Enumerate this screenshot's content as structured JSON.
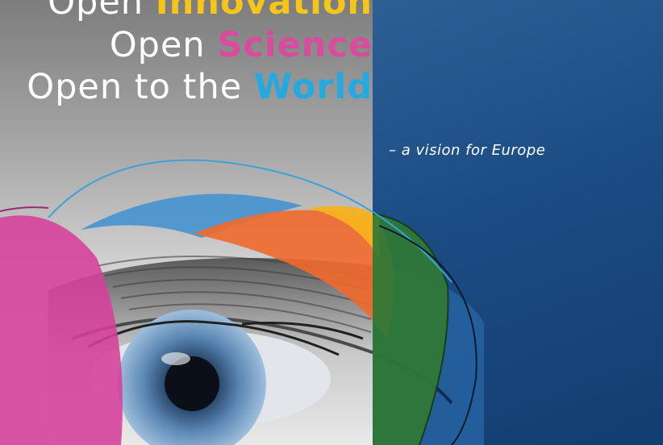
{
  "cover": {
    "line1": {
      "open": "Open",
      "highlight": "Innovation"
    },
    "line2": {
      "open": "Open",
      "highlight": "Science"
    },
    "line3": {
      "open": "Open to the",
      "highlight": "World"
    },
    "subtitle": "– a vision for Europe"
  },
  "colors": {
    "innovation": "#f5c519",
    "science": "#d94b9d",
    "world": "#24a9e1",
    "panel_blue": "#1c4c84",
    "magenta_arc": "#d63f9a",
    "blue_arc": "#3e8fd0",
    "orange_arc": "#ef6a2c",
    "yellow_arc": "#f6b21d",
    "green_arc": "#2f7a35"
  },
  "imagery": {
    "photo": "eye-closeup",
    "decoration": "colored-arcs"
  }
}
